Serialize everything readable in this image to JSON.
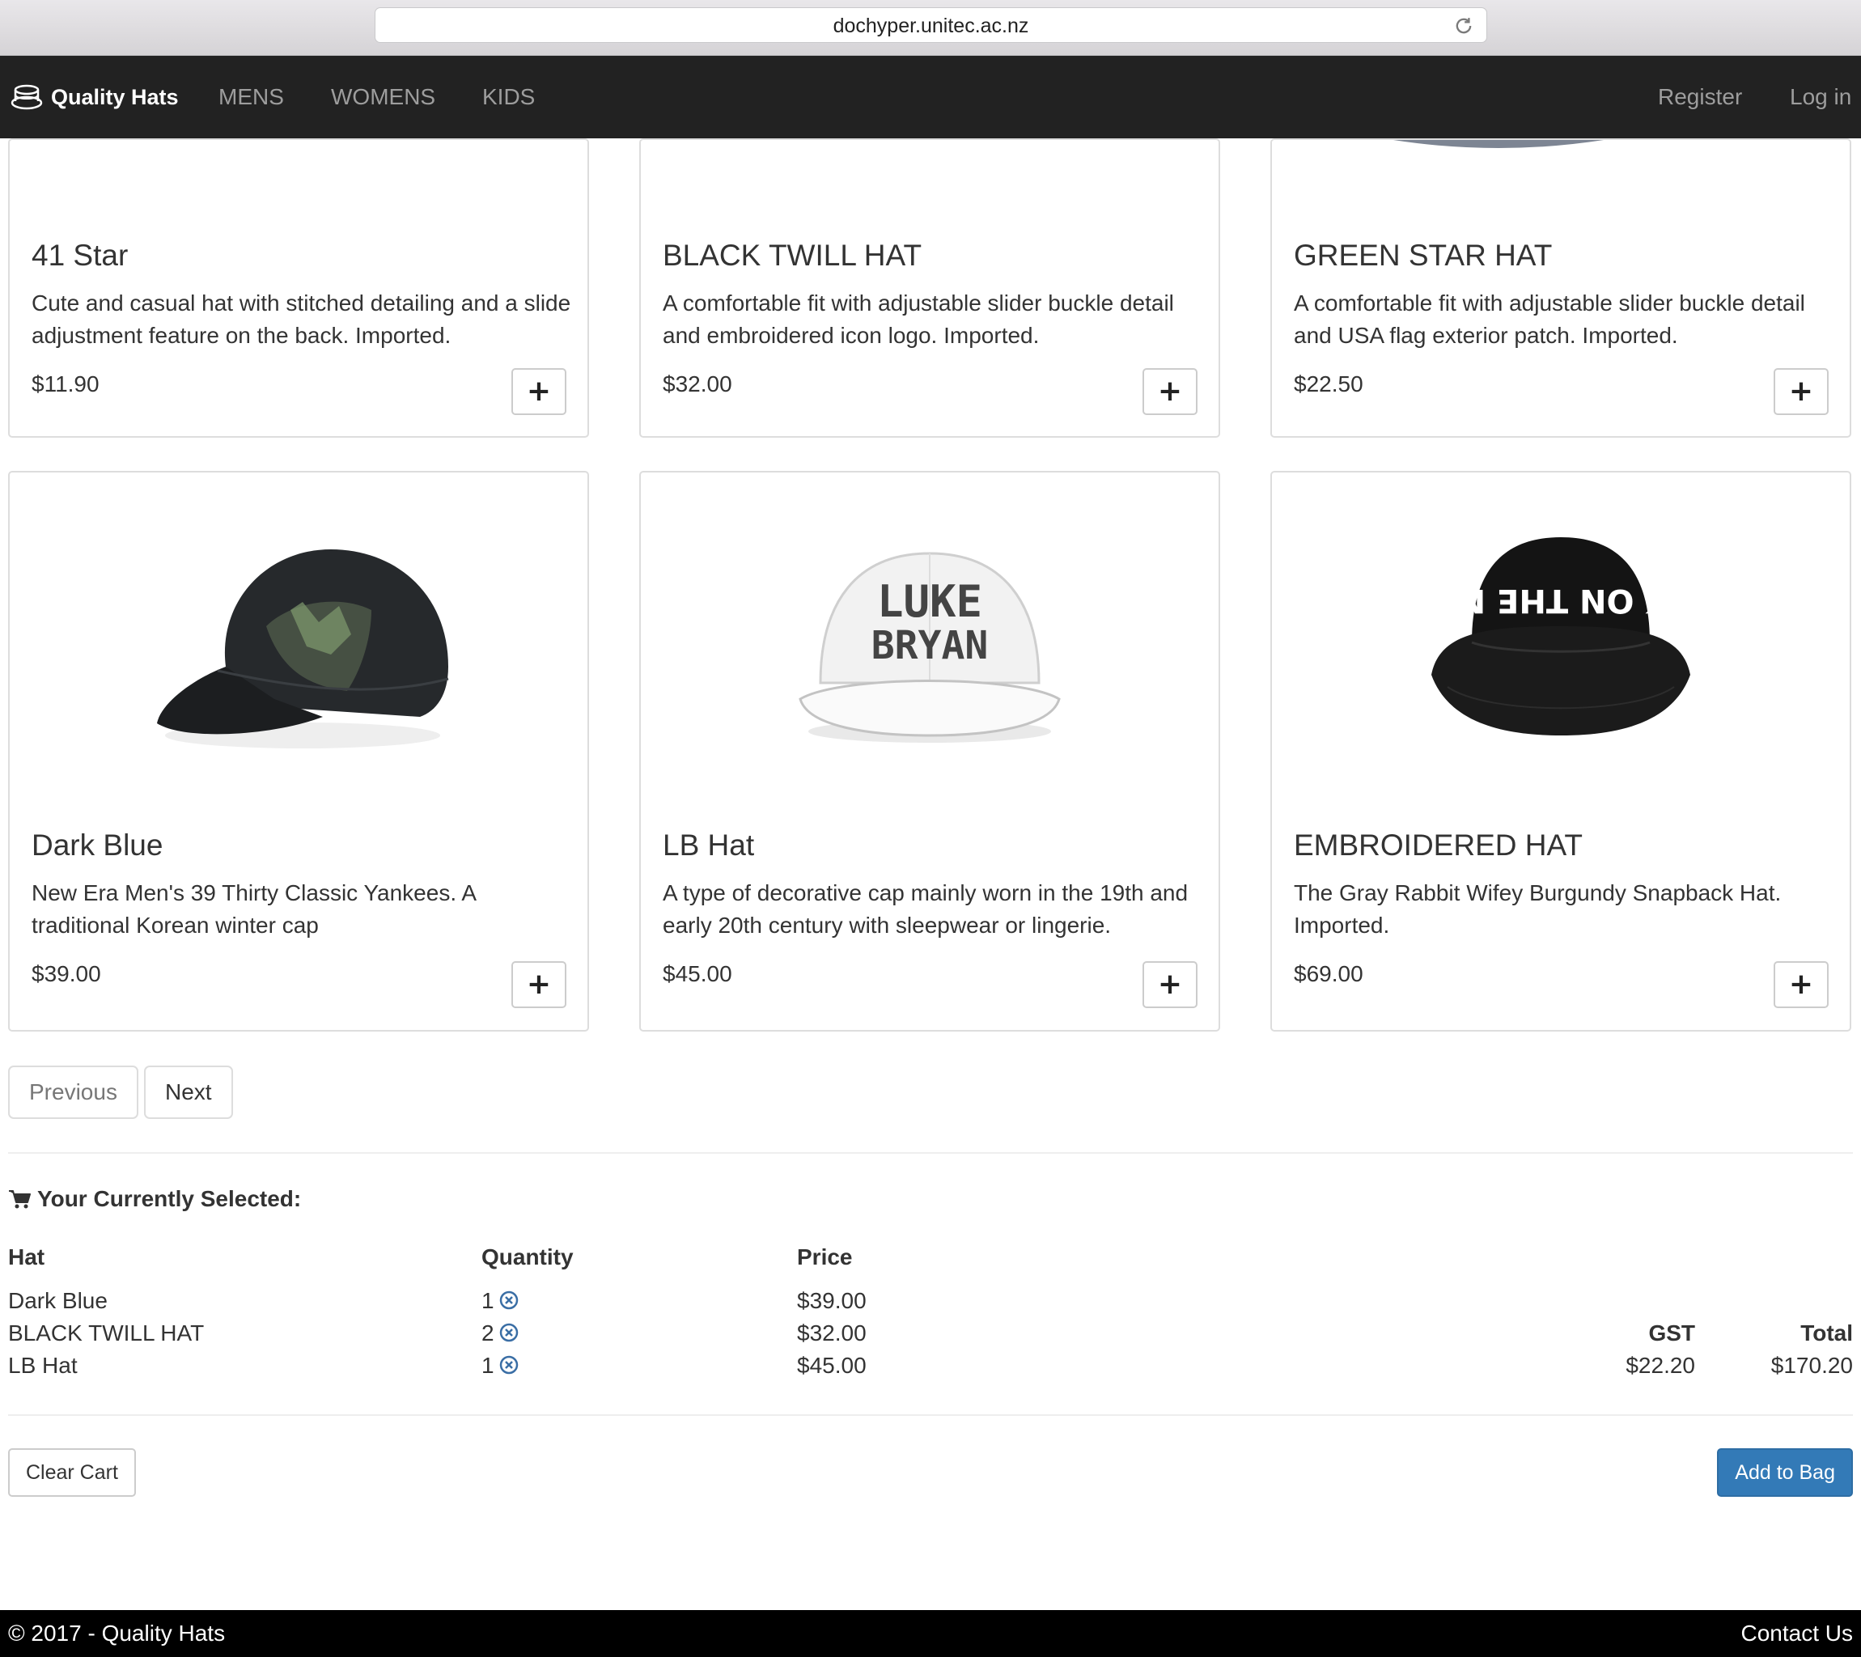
{
  "browser": {
    "url": "dochyper.unitec.ac.nz"
  },
  "navbar": {
    "brand": "Quality Hats",
    "links": [
      "MENS",
      "WOMENS",
      "KIDS"
    ],
    "register": "Register",
    "login": "Log in"
  },
  "products": [
    {
      "title": "41 Star",
      "desc": "Cute and casual hat with stitched detailing and a slide adjustment feature on the back. Imported.",
      "price": "$11.90"
    },
    {
      "title": "BLACK TWILL HAT",
      "desc": "A comfortable fit with adjustable slider buckle detail and embroidered icon logo. Imported.",
      "price": "$32.00"
    },
    {
      "title": "GREEN STAR HAT",
      "desc": "A comfortable fit with adjustable slider buckle detail and USA flag exterior patch. Imported.",
      "price": "$22.50"
    },
    {
      "title": "Dark Blue",
      "desc": "New Era Men's 39 Thirty Classic Yankees. A traditional Korean winter cap",
      "price": "$39.00"
    },
    {
      "title": "LB Hat",
      "desc": "A type of decorative cap mainly worn in the 19th and early 20th century with sleepwear or lingerie.",
      "price": "$45.00"
    },
    {
      "title": "EMBROIDERED HAT",
      "desc": "The Gray Rabbit Wifey Burgundy Snapback Hat. Imported.",
      "price": "$69.00"
    }
  ],
  "product_images": {
    "lb_hat_line1": "LUKE",
    "lb_hat_line2": "BRYAN",
    "embroidered_text": "WALK ON THE MOON"
  },
  "icons": {
    "brand": "hat-icon",
    "add": "plus-icon",
    "cart": "shopping-cart-icon",
    "remove": "circle-x-icon",
    "reload": "reload-icon"
  },
  "pager": {
    "previous": "Previous",
    "next": "Next"
  },
  "cart": {
    "title": "Your Currently Selected:",
    "headers": {
      "hat": "Hat",
      "quantity": "Quantity",
      "price": "Price",
      "gst": "GST",
      "total": "Total"
    },
    "rows": [
      {
        "hat": "Dark Blue",
        "quantity": "1",
        "price": "$39.00"
      },
      {
        "hat": "BLACK TWILL HAT",
        "quantity": "2",
        "price": "$32.00"
      },
      {
        "hat": "LB Hat",
        "quantity": "1",
        "price": "$45.00"
      }
    ],
    "gst": "$22.20",
    "total": "$170.20",
    "clear_label": "Clear Cart",
    "add_label": "Add to Bag"
  },
  "footer": {
    "copyright": "© 2017 - Quality Hats",
    "contact": "Contact Us"
  },
  "colors": {
    "navbar": "#222222",
    "primary": "#337ab7",
    "footer": "#000000",
    "remove_icon": "#3a6ea5"
  }
}
